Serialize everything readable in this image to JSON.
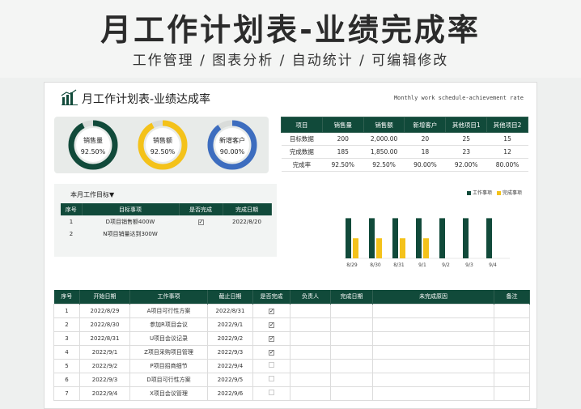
{
  "banner": {
    "title": "月工作计划表-业绩完成率",
    "subtitle": "工作管理 / 图表分析 / 自动统计 / 可编辑修改"
  },
  "sheet": {
    "title": "月工作计划表-业绩达成率",
    "title_en": "Monthly work schedule-achievement rate"
  },
  "donuts": [
    {
      "label": "销售量",
      "value": "92.50%",
      "percent": 92.5,
      "color": "#114a3a"
    },
    {
      "label": "销售额",
      "value": "92.50%",
      "percent": 92.5,
      "color": "#f4c21a"
    },
    {
      "label": "新增客户",
      "value": "90.00%",
      "percent": 90.0,
      "color": "#3d6dbf"
    }
  ],
  "stats": {
    "headers": [
      "项目",
      "销售量",
      "销售额",
      "新增客户",
      "其他项目1",
      "其他项目2"
    ],
    "rows": [
      [
        "目标数据",
        "200",
        "2,000.00",
        "20",
        "25",
        "15"
      ],
      [
        "完成数据",
        "185",
        "1,850.00",
        "18",
        "23",
        "12"
      ],
      [
        "完成率",
        "92.50%",
        "92.50%",
        "90.00%",
        "92.00%",
        "80.00%"
      ]
    ]
  },
  "goals": {
    "title": "本月工作目标▼",
    "headers": [
      "序号",
      "目标事项",
      "是否完成",
      "完成日期"
    ],
    "rows": [
      {
        "no": "1",
        "item": "D项目销售额400W",
        "done": true,
        "date": "2022/8/20"
      },
      {
        "no": "2",
        "item": "N项目销量达到300W",
        "done": false,
        "date": ""
      }
    ]
  },
  "chart_data": {
    "type": "bar",
    "categories": [
      "8/29",
      "8/30",
      "8/31",
      "9/1",
      "9/2",
      "9/3",
      "9/4"
    ],
    "series": [
      {
        "name": "工作事项",
        "values": [
          4,
          4,
          4,
          4,
          4,
          4,
          4
        ],
        "color": "#114a3a"
      },
      {
        "name": "完成事项",
        "values": [
          2,
          2,
          2,
          2,
          0,
          0,
          0
        ],
        "color": "#f4c21a"
      }
    ],
    "ylim": [
      0,
      5
    ]
  },
  "tasks": {
    "headers": [
      "序号",
      "开始日期",
      "工作事项",
      "截止日期",
      "是否完成",
      "负责人",
      "完成日期",
      "未完成原因",
      "备注"
    ],
    "rows": [
      {
        "no": "1",
        "start": "2022/8/29",
        "item": "A项目可行性方案",
        "due": "2022/8/31",
        "done": true
      },
      {
        "no": "2",
        "start": "2022/8/30",
        "item": "参加R项目会议",
        "due": "2022/9/1",
        "done": true
      },
      {
        "no": "3",
        "start": "2022/8/31",
        "item": "U项目会议记录",
        "due": "2022/9/2",
        "done": true
      },
      {
        "no": "4",
        "start": "2022/9/1",
        "item": "Z项目采购项目管理",
        "due": "2022/9/3",
        "done": true
      },
      {
        "no": "5",
        "start": "2022/9/2",
        "item": "P项目招商细节",
        "due": "2022/9/4",
        "done": false
      },
      {
        "no": "6",
        "start": "2022/9/3",
        "item": "D项目可行性方案",
        "due": "2022/9/5",
        "done": false
      },
      {
        "no": "7",
        "start": "2022/9/4",
        "item": "X项目会议管理",
        "due": "2022/9/6",
        "done": false
      }
    ]
  }
}
